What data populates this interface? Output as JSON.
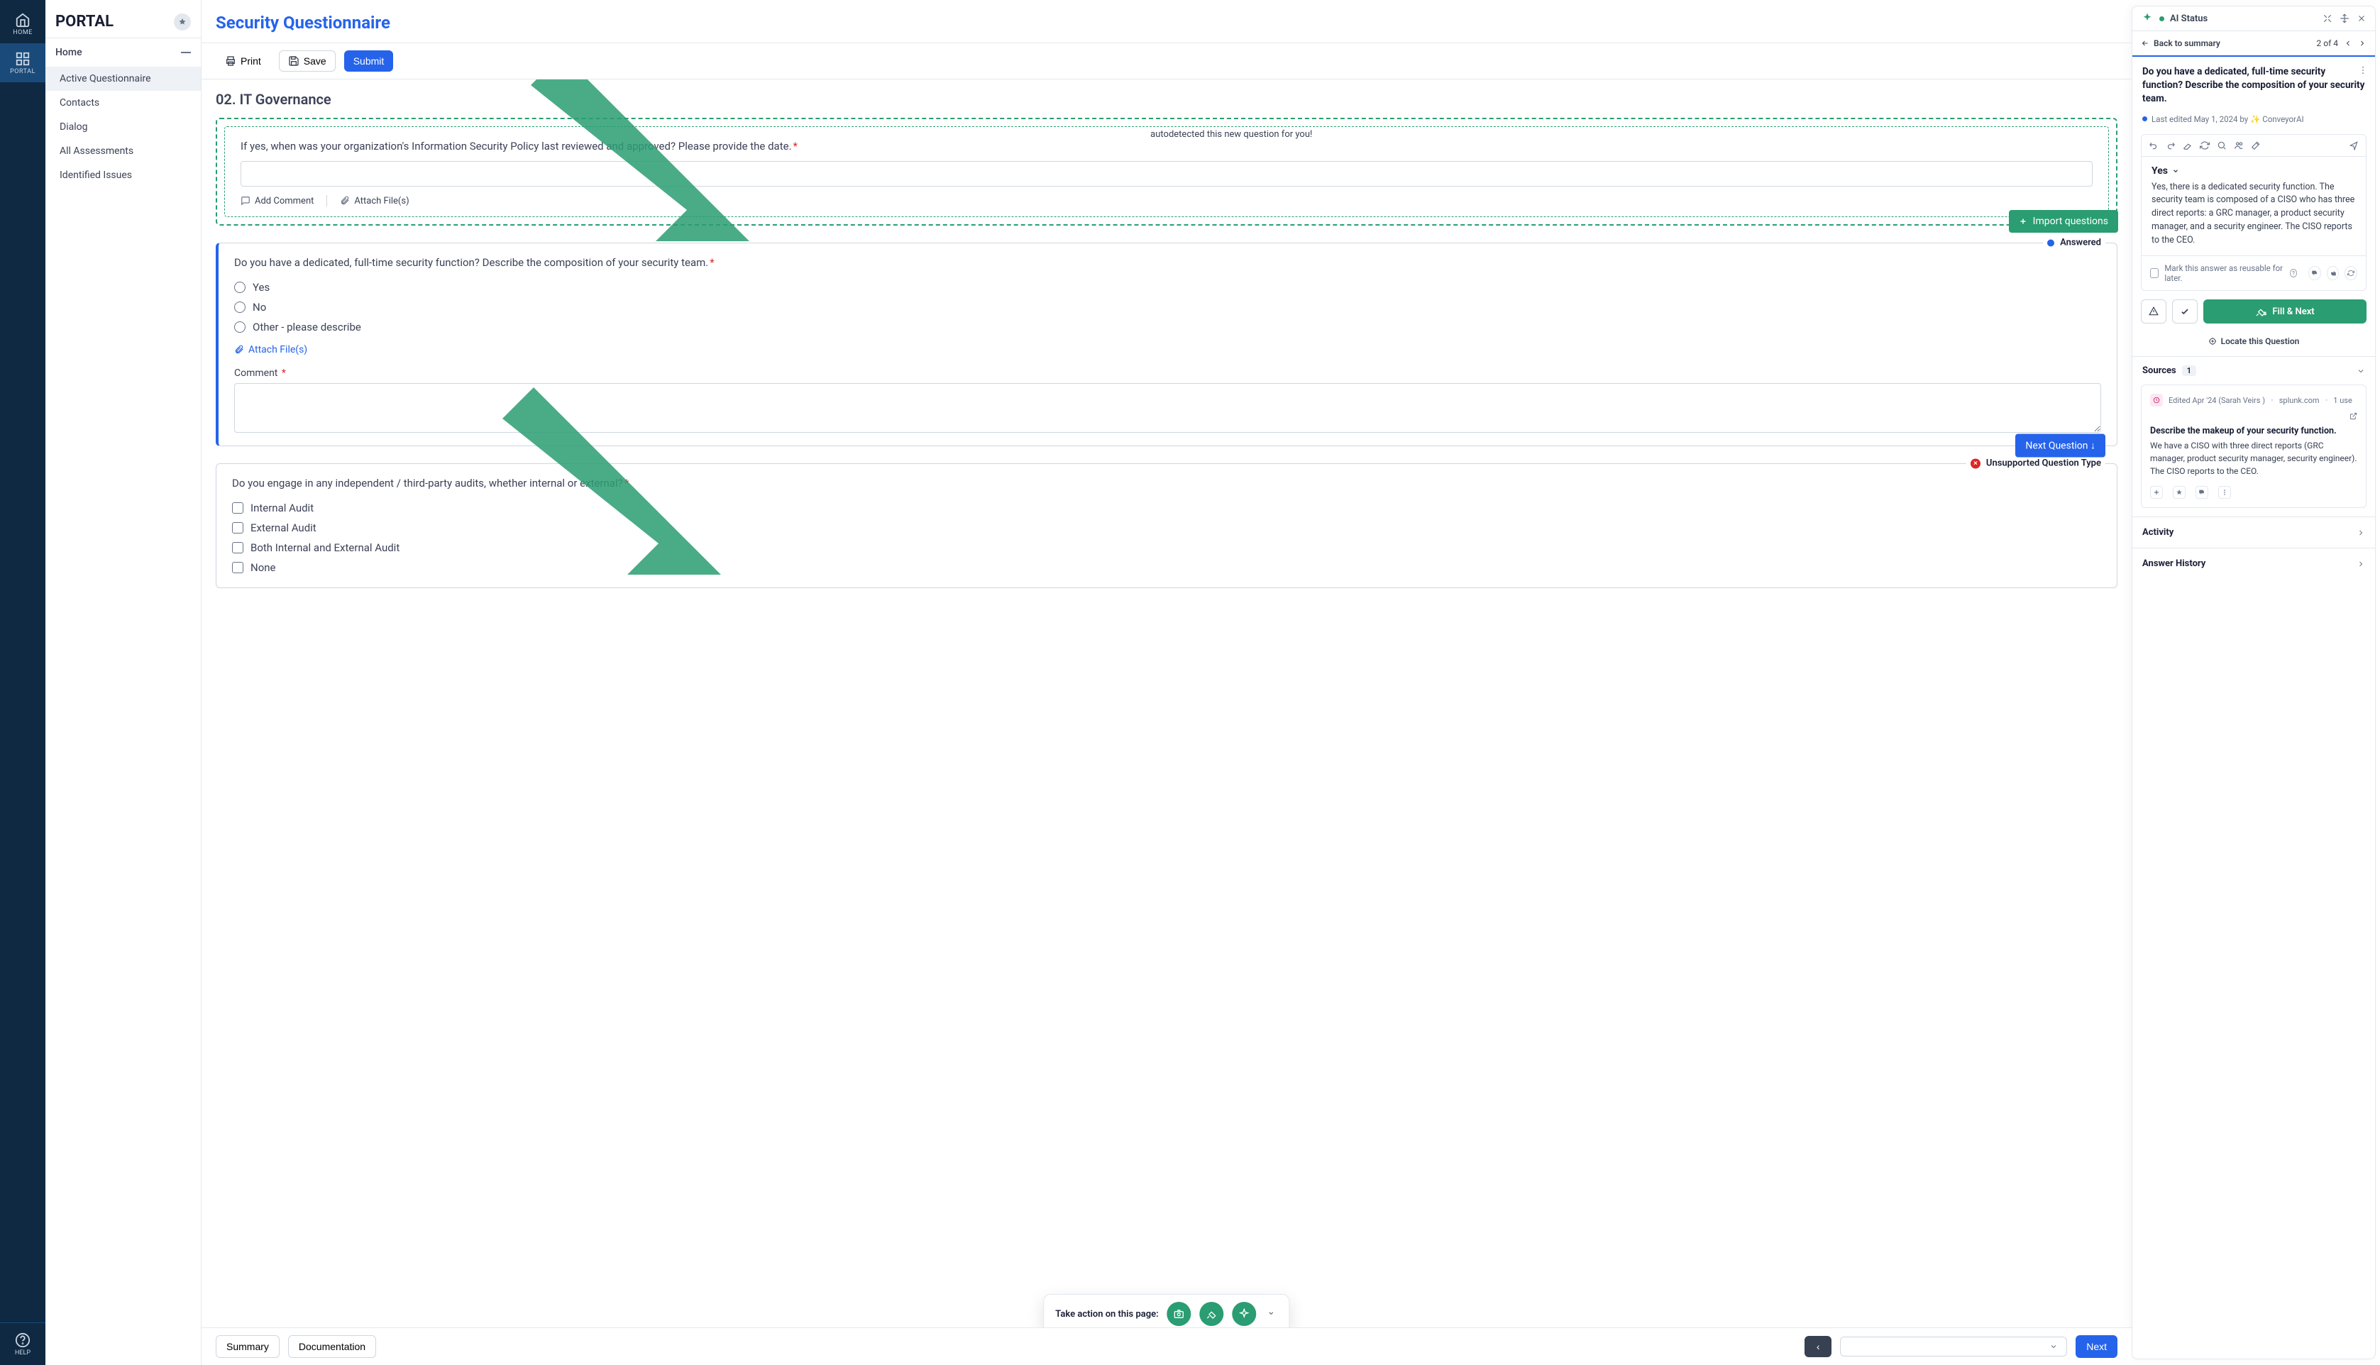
{
  "rail": {
    "home": "HOME",
    "portal": "PORTAL",
    "help": "HELP"
  },
  "sidenav": {
    "title": "PORTAL",
    "section": "Home",
    "items": [
      "Active Questionnaire",
      "Contacts",
      "Dialog",
      "All Assessments",
      "Identified Issues"
    ]
  },
  "main": {
    "title": "Security Questionnaire",
    "toolbar": {
      "print": "Print",
      "save": "Save",
      "submit": "Submit"
    },
    "section": "02. IT Governance",
    "q1": {
      "autodetect": "autodetected this new question for you!",
      "text": "If yes, when was your organization's Information Security Policy last reviewed and approved? Please provide the date.",
      "add_comment": "Add Comment",
      "attach": "Attach File(s)",
      "import": "Import questions"
    },
    "q2": {
      "badge": "Answered",
      "text": "Do you have a dedicated, full-time security function? Describe the composition of your security team.",
      "opts": [
        "Yes",
        "No",
        "Other - please describe"
      ],
      "attach": "Attach File(s)",
      "comment_label": "Comment",
      "next": "Next Question ↓"
    },
    "q3": {
      "badge": "Unsupported Question Type",
      "text": "Do you engage in any independent / third-party audits, whether internal or external?",
      "opts": [
        "Internal Audit",
        "External Audit",
        "Both Internal and External Audit",
        "None"
      ]
    },
    "bottom": {
      "summary": "Summary",
      "documentation": "Documentation",
      "next": "Next"
    },
    "pill": {
      "label": "Take action on this page:"
    }
  },
  "panel": {
    "status": "AI Status",
    "back": "Back to summary",
    "pager": "2 of 4",
    "question": "Do you have a dedicated, full-time security function? Describe the composition of your security team.",
    "edited": "Last edited May 1, 2024 by ✨ ConveyorAI",
    "answer_label": "Yes",
    "answer_text": "Yes, there is a dedicated security function. The security team is composed of a CISO who has three direct reports: a GRC manager, a product security manager, and a security engineer. The CISO reports to the CEO.",
    "reusable": "Mark this answer as reusable for later.",
    "fill_next": "Fill & Next",
    "locate": "Locate this Question",
    "sources_label": "Sources",
    "sources_count": "1",
    "source": {
      "meta_edited": "Edited Apr '24 (Sarah Veirs )",
      "domain": "splunk.com",
      "use": "1 use",
      "title": "Describe the makeup of your security function.",
      "text": "We have a CISO with three direct reports (GRC manager, product security manager, security engineer). The CISO reports to the CEO."
    },
    "activity": "Activity",
    "history": "Answer History"
  },
  "colors": {
    "green": "#2a9d72",
    "blue": "#2563eb"
  }
}
